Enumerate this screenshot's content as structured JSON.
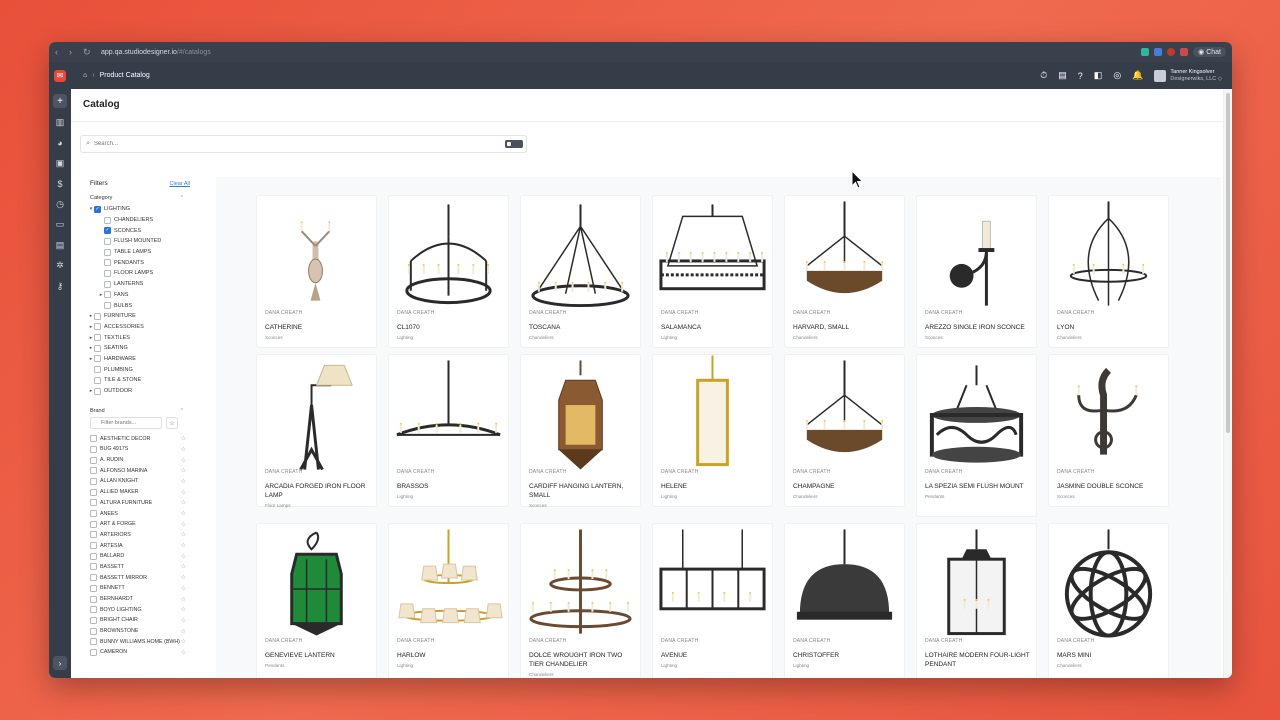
{
  "browser": {
    "url_host": "app.qa.studiodesigner.io",
    "url_path": "/#/catalogs",
    "chat_label": "Chat"
  },
  "appbar": {
    "breadcrumb": "Product Catalog",
    "user_name": "Tanner Kingsolver",
    "user_company": "Designerwiks, LLC ◇"
  },
  "page": {
    "title": "Catalog",
    "search_placeholder": "Search..."
  },
  "filters": {
    "title": "Filters",
    "clear_all": "Clear All",
    "category_title": "Category",
    "categories": [
      {
        "label": "LIGHTING",
        "level": 0,
        "caret": "▾",
        "checked": true
      },
      {
        "label": "CHANDELIERS",
        "level": 1,
        "caret": "",
        "checked": false
      },
      {
        "label": "SCONCES",
        "level": 1,
        "caret": "",
        "checked": true
      },
      {
        "label": "FLUSH MOUNTED",
        "level": 1,
        "caret": "",
        "checked": false
      },
      {
        "label": "TABLE LAMPS",
        "level": 1,
        "caret": "",
        "checked": false
      },
      {
        "label": "PENDANTS",
        "level": 1,
        "caret": "",
        "checked": false
      },
      {
        "label": "FLOOR LAMPS",
        "level": 1,
        "caret": "",
        "checked": false
      },
      {
        "label": "LANTERNS",
        "level": 1,
        "caret": "",
        "checked": false
      },
      {
        "label": "FANS",
        "level": 1,
        "caret": "▸",
        "checked": false
      },
      {
        "label": "BULBS",
        "level": 1,
        "caret": "",
        "checked": false
      },
      {
        "label": "FURNITURE",
        "level": 0,
        "caret": "▸",
        "checked": false
      },
      {
        "label": "ACCESSORIES",
        "level": 0,
        "caret": "▸",
        "checked": false
      },
      {
        "label": "TEXTILES",
        "level": 0,
        "caret": "▸",
        "checked": false
      },
      {
        "label": "SEATING",
        "level": 0,
        "caret": "▸",
        "checked": false
      },
      {
        "label": "HARDWARE",
        "level": 0,
        "caret": "▸",
        "checked": false
      },
      {
        "label": "PLUMBING",
        "level": 0,
        "caret": "",
        "checked": false
      },
      {
        "label": "TILE & STONE",
        "level": 0,
        "caret": "",
        "checked": false
      },
      {
        "label": "OUTDOOR",
        "level": 0,
        "caret": "▸",
        "checked": false
      }
    ],
    "brand_title": "Brand",
    "brand_placeholder": "Filter brands...",
    "brands": [
      "AESTHETIC DECOR",
      "BUG 4917S",
      "A. RUDIN",
      "ALFONSO MARINA",
      "ALLAN KNIGHT",
      "ALLIED MAKER",
      "ALTURA FURNITURE",
      "ANEES",
      "ART & FORGE",
      "ARTERIORS",
      "ARTESIA",
      "BALLARD",
      "BASSETT",
      "BASSETT MIRROR",
      "BENNETT",
      "BERNHARDT",
      "BOYD LIGHTING",
      "BRIGHT CHAIR",
      "BROWNSTONE",
      "BUNNY WILLIAMS HOME (BWH)",
      "CAMERON"
    ]
  },
  "products": [
    {
      "brand": "DANA CREATH",
      "name": "CATHERINE",
      "category": "Sconces",
      "icon": "sconce-double"
    },
    {
      "brand": "DANA CREATH",
      "name": "CL1070",
      "category": "Lighting",
      "icon": "chandelier-ring"
    },
    {
      "brand": "DANA CREATH",
      "name": "TOSCANA",
      "category": "Chandeliers",
      "icon": "chandelier-wheel"
    },
    {
      "brand": "DANA CREATH",
      "name": "SALAMANCA",
      "category": "Lighting",
      "icon": "chandelier-linear"
    },
    {
      "brand": "DANA CREATH",
      "name": "HARVARD, SMALL",
      "category": "Chandeliers",
      "icon": "chandelier-crown"
    },
    {
      "brand": "DANA CREATH",
      "name": "AREZZO SINGLE IRON SCONCE",
      "category": "Sconces",
      "icon": "sconce-single"
    },
    {
      "brand": "DANA CREATH",
      "name": "LYON",
      "category": "Chandeliers",
      "icon": "chandelier-tall"
    },
    {
      "brand": "DANA CREATH",
      "name": "ARCADIA FORGED IRON FLOOR LAMP",
      "category": "Floor Lamps",
      "icon": "floor-lamp"
    },
    {
      "brand": "DANA CREATH",
      "name": "BRASSOS",
      "category": "Lighting",
      "icon": "chandelier-wide"
    },
    {
      "brand": "DANA CREATH",
      "name": "CARDIFF HANGING LANTERN, SMALL",
      "category": "Sconces",
      "icon": "lantern-copper"
    },
    {
      "brand": "DANA CREATH",
      "name": "HELENE",
      "category": "Lighting",
      "icon": "pendant-cylinder"
    },
    {
      "brand": "DANA CREATH",
      "name": "CHAMPAGNE",
      "category": "Chandeliers",
      "icon": "chandelier-crown"
    },
    {
      "brand": "DANA CREATH",
      "name": "LA SPEZIA SEMI FLUSH MOUNT",
      "category": "Pendants",
      "icon": "flush-drum"
    },
    {
      "brand": "DANA CREATH",
      "name": "JASMINE DOUBLE SCONCE",
      "category": "Sconces",
      "icon": "sconce-ornate"
    },
    {
      "brand": "DANA CREATH",
      "name": "GENEVIEVE LANTERN",
      "category": "Pendants",
      "icon": "lantern-green"
    },
    {
      "brand": "DANA CREATH",
      "name": "HARLOW",
      "category": "Lighting",
      "icon": "chandelier-shades"
    },
    {
      "brand": "DANA CREATH",
      "name": "DOLCE WROUGHT IRON TWO TIER CHANDELIER",
      "category": "Chandeliers",
      "icon": "chandelier-tier"
    },
    {
      "brand": "DANA CREATH",
      "name": "AVENUE",
      "category": "Lighting",
      "icon": "linear-box"
    },
    {
      "brand": "DANA CREATH",
      "name": "CHRISTOFFER",
      "category": "Lighting",
      "icon": "pendant-dome"
    },
    {
      "brand": "DANA CREATH",
      "name": "LOTHAIRE MODERN FOUR-LIGHT PENDANT",
      "category": "",
      "icon": "lantern-glass"
    },
    {
      "brand": "DANA CREATH",
      "name": "MARS MINI",
      "category": "Chandeliers",
      "icon": "orb"
    }
  ],
  "colors": {
    "accent": "#2a73d6",
    "appbar": "#353d49",
    "logo": "#e9473a"
  }
}
